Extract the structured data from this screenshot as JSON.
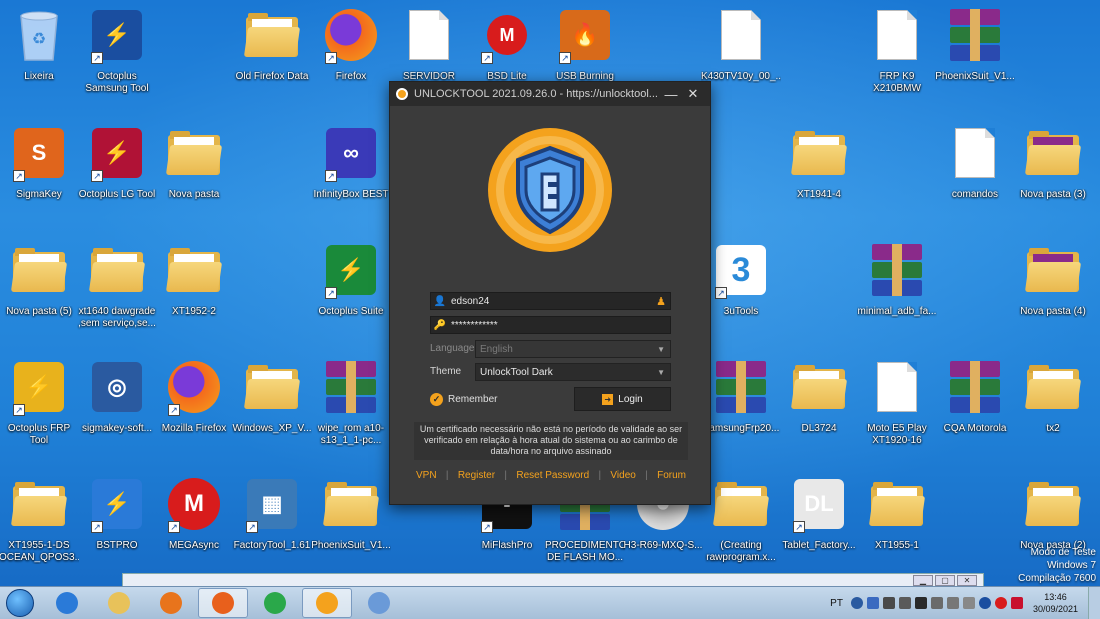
{
  "desktop": {
    "icons": [
      {
        "id": "lixeira",
        "label": "Lixeira",
        "kind": "trash",
        "shortcut": false
      },
      {
        "id": "octoplus-samsung",
        "label": "Octoplus Samsung Tool",
        "kind": "app",
        "color": "#1a4ea0",
        "glyph": "⚡",
        "shortcut": true
      },
      {
        "id": "old-firefox-data",
        "label": "Old Firefox Data",
        "kind": "folder",
        "shortcut": false
      },
      {
        "id": "firefox",
        "label": "Firefox",
        "kind": "firefox",
        "shortcut": true
      },
      {
        "id": "servidor-xiomi",
        "label": "SERVIDOR XIOMI",
        "kind": "doc",
        "shortcut": false
      },
      {
        "id": "bsd-lite",
        "label": "BSD Lite",
        "kind": "motorola",
        "shortcut": true
      },
      {
        "id": "usb-burning",
        "label": "USB Burning",
        "kind": "app",
        "color": "#d86a1a",
        "glyph": "🔥",
        "shortcut": true
      },
      {
        "id": "k430tv",
        "label": "K430TV10y_00_...",
        "kind": "doc",
        "shortcut": false
      },
      {
        "id": "frp-k9",
        "label": "FRP K9 X210BMW",
        "kind": "doc",
        "shortcut": false
      },
      {
        "id": "phoenixsuit-top",
        "label": "PhoenixSuit_V1...",
        "kind": "rar",
        "shortcut": false
      },
      {
        "id": "sigmakey",
        "label": "SigmaKey",
        "kind": "app",
        "color": "#e0651c",
        "glyph": "S",
        "shortcut": true
      },
      {
        "id": "octoplus-lg",
        "label": "Octoplus LG Tool",
        "kind": "app",
        "color": "#b01236",
        "glyph": "⚡",
        "shortcut": true
      },
      {
        "id": "nova-pasta",
        "label": "Nova pasta",
        "kind": "folder",
        "shortcut": false
      },
      {
        "id": "infinitybox",
        "label": "InfinityBox BEST",
        "kind": "app",
        "color": "#3a3ab8",
        "glyph": "∞",
        "shortcut": true
      },
      {
        "id": "xt1941",
        "label": "XT1941-4",
        "kind": "folder",
        "shortcut": false
      },
      {
        "id": "comandos",
        "label": "comandos",
        "kind": "doc",
        "shortcut": false
      },
      {
        "id": "nova-pasta-3",
        "label": "Nova pasta (3)",
        "kind": "folder-rar",
        "shortcut": false
      },
      {
        "id": "nova-pasta-5",
        "label": "Nova pasta (5)",
        "kind": "folder",
        "shortcut": false
      },
      {
        "id": "xt1640",
        "label": "xt1640 dawgrade ,sem serviço,se...",
        "kind": "folder",
        "shortcut": false
      },
      {
        "id": "xt1952",
        "label": "XT1952-2",
        "kind": "folder",
        "shortcut": false
      },
      {
        "id": "octoplus-suite",
        "label": "Octoplus Suite",
        "kind": "app",
        "color": "#1a8a3a",
        "glyph": "⚡",
        "shortcut": true
      },
      {
        "id": "3utools",
        "label": "3uTools",
        "kind": "three",
        "shortcut": true
      },
      {
        "id": "minimal-adb",
        "label": "minimal_adb_fa...",
        "kind": "rar",
        "shortcut": false
      },
      {
        "id": "nova-pasta-4",
        "label": "Nova pasta (4)",
        "kind": "folder-rar",
        "shortcut": false
      },
      {
        "id": "octoplus-frp",
        "label": "Octoplus FRP Tool",
        "kind": "app",
        "color": "#e8b21c",
        "glyph": "⚡",
        "shortcut": true
      },
      {
        "id": "sigmakey-soft",
        "label": "sigmakey-soft...",
        "kind": "app",
        "color": "#2a5aa0",
        "glyph": "◎",
        "shortcut": false
      },
      {
        "id": "mozilla-firefox",
        "label": "Mozilla Firefox",
        "kind": "firefox",
        "shortcut": true
      },
      {
        "id": "windows-xp",
        "label": "Windows_XP_V...",
        "kind": "folder",
        "shortcut": false
      },
      {
        "id": "wipe-rom",
        "label": "wipe_rom a10-s13_1_1-pc...",
        "kind": "rar",
        "shortcut": false
      },
      {
        "id": "samsungfrp",
        "label": "SamsungFrp20...",
        "kind": "rar",
        "shortcut": false
      },
      {
        "id": "dl3724",
        "label": "DL3724",
        "kind": "folder",
        "shortcut": false
      },
      {
        "id": "moto-e5",
        "label": "Moto E5 Play XT1920-16",
        "kind": "doc",
        "shortcut": false
      },
      {
        "id": "cqa-motorola",
        "label": "CQA Motorola",
        "kind": "rar",
        "shortcut": false
      },
      {
        "id": "tx2",
        "label": "tx2",
        "kind": "folder",
        "shortcut": false
      },
      {
        "id": "xt1955-ds",
        "label": "XT1955-1-DS OCEAN_QPOS3...",
        "kind": "folder",
        "shortcut": false
      },
      {
        "id": "bstpro",
        "label": "BSTPRO",
        "kind": "app",
        "color": "#2a7ad8",
        "glyph": "⚡",
        "shortcut": true
      },
      {
        "id": "megasync",
        "label": "MEGAsync",
        "kind": "mega",
        "shortcut": true
      },
      {
        "id": "factorytool",
        "label": "FactoryTool_1.61",
        "kind": "app",
        "color": "#3a7ab8",
        "glyph": "▦",
        "shortcut": true
      },
      {
        "id": "phoenixsuit-bottom",
        "label": "PhoenixSuit_V1...",
        "kind": "folder",
        "shortcut": false
      },
      {
        "id": "miflashpro",
        "label": "MiFlashPro",
        "kind": "app",
        "color": "#111111",
        "glyph": "▪",
        "shortcut": true
      },
      {
        "id": "procedimento",
        "label": "PROCEDIMENTO DE FLASH MO...",
        "kind": "rar",
        "shortcut": false
      },
      {
        "id": "h3-r69",
        "label": "H3-R69-MXQ-S...",
        "kind": "disc",
        "shortcut": false
      },
      {
        "id": "creating-rawprogram",
        "label": "(Creating rawprogram.x...",
        "kind": "folder",
        "shortcut": false
      },
      {
        "id": "tablet-factory",
        "label": "Tablet_Factory...",
        "kind": "app",
        "color": "#e8e8e8",
        "glyph": "DL",
        "shortcut": true
      },
      {
        "id": "xt1955-1",
        "label": "XT1955-1",
        "kind": "folder",
        "shortcut": false
      },
      {
        "id": "nova-pasta-2",
        "label": "Nova pasta (2)",
        "kind": "folder",
        "shortcut": false
      }
    ],
    "watermark": [
      "Modo de Teste",
      "Windows 7",
      "Compilação 7600"
    ]
  },
  "unlocktool": {
    "title": "UNLOCKTOOL 2021.09.26.0 - https://unlocktool...",
    "minimize": "—",
    "close": "✕",
    "username": "edson24",
    "password": "************",
    "language_label": "Language",
    "language_value": "English",
    "theme_label": "Theme",
    "theme_value": "UnlockTool Dark",
    "remember_label": "Remember",
    "login_label": "Login",
    "notice": "Um certificado necessário não está no período de validade ao ser verificado em relação à hora atual do sistema ou ao carimbo de data/hora no arquivo assinado",
    "links": [
      "VPN",
      "Register",
      "Reset Password",
      "Video",
      "Forum"
    ],
    "accent": "#f4a21d"
  },
  "taskbar": {
    "apps": [
      {
        "id": "ie",
        "color": "#2a7ad8"
      },
      {
        "id": "explorer",
        "color": "#e8c25a"
      },
      {
        "id": "media-player",
        "color": "#e8741c"
      },
      {
        "id": "firefox",
        "color": "#e8601c",
        "active": true
      },
      {
        "id": "chrome",
        "color": "#2aa84a"
      },
      {
        "id": "unlocktool",
        "color": "#f4a21d",
        "active": true
      },
      {
        "id": "paint",
        "color": "#6a9ad8"
      }
    ],
    "language": "PT",
    "time": "13:46",
    "date": "30/09/2021"
  }
}
